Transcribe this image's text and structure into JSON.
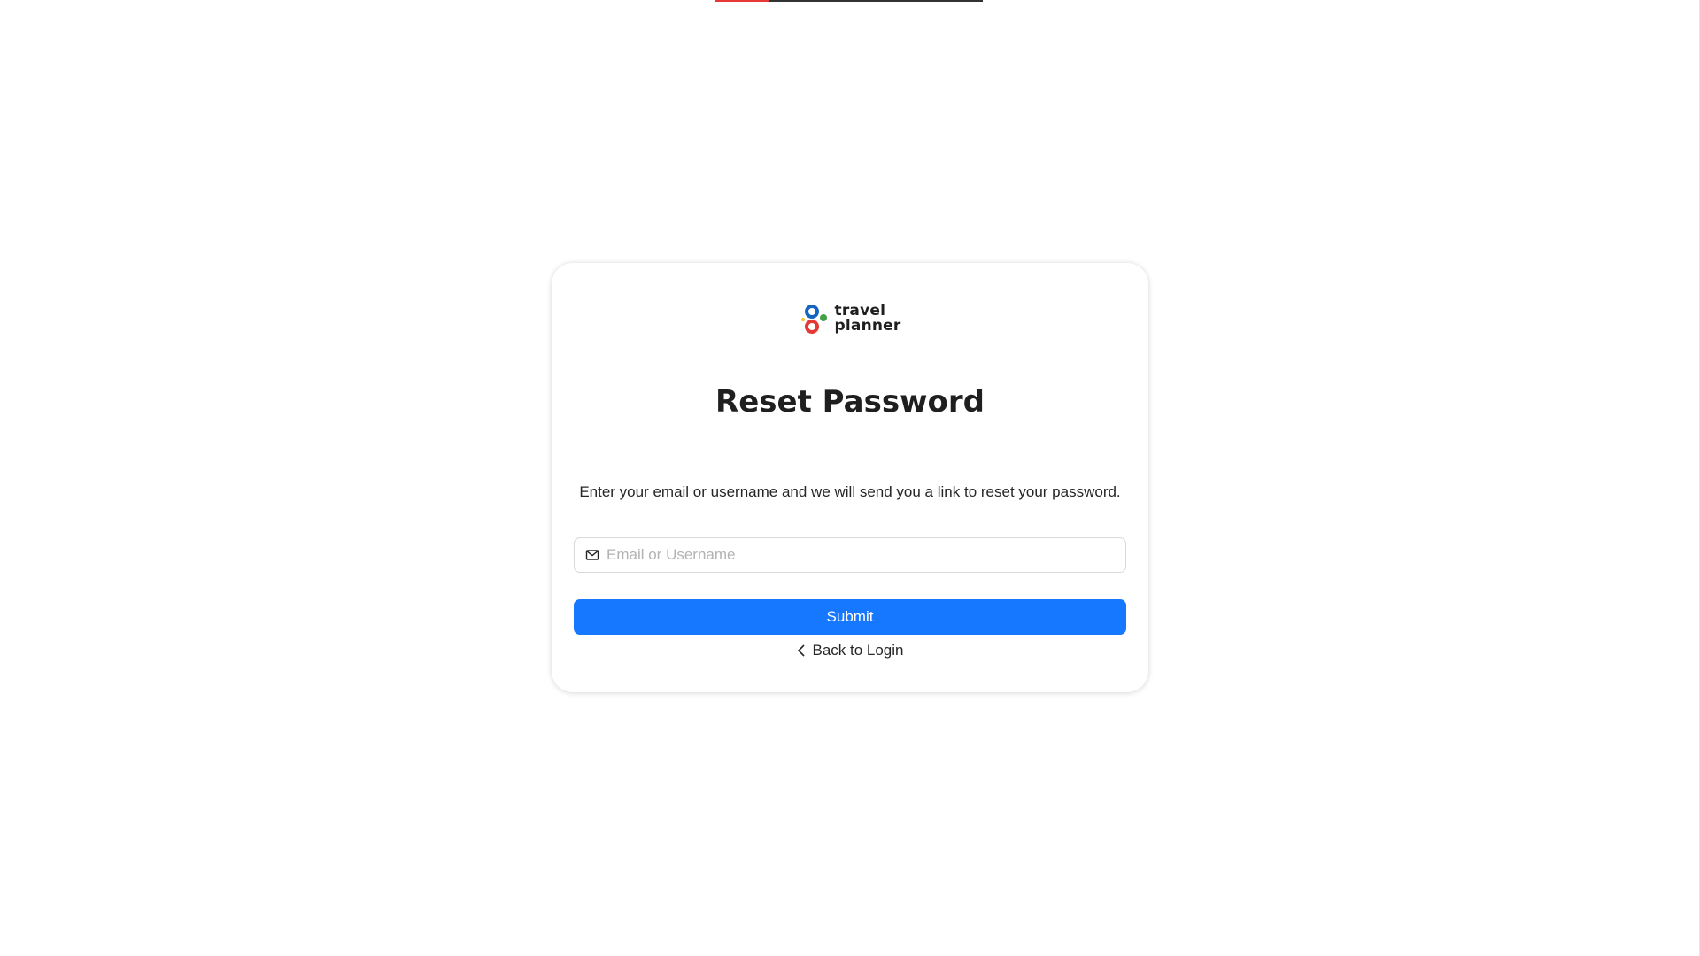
{
  "loading_bar": {
    "progress": 0.2,
    "fill_color": "#e53935",
    "track_color": "#333333"
  },
  "brand": {
    "line1": "travel",
    "line2": "planner",
    "colors": [
      "#1565c0",
      "#43a047",
      "#e53935",
      "#fbc02d"
    ]
  },
  "title": "Reset Password",
  "description": "Enter your email or username and we will send you a link to reset your password.",
  "form": {
    "identifier_placeholder": "Email or Username",
    "identifier_value": "",
    "identifier_icon": "mail-icon",
    "submit_label": "Submit",
    "primary_color": "#1677ff"
  },
  "back_link": {
    "label": "Back to Login",
    "icon": "chevron-left-icon"
  }
}
